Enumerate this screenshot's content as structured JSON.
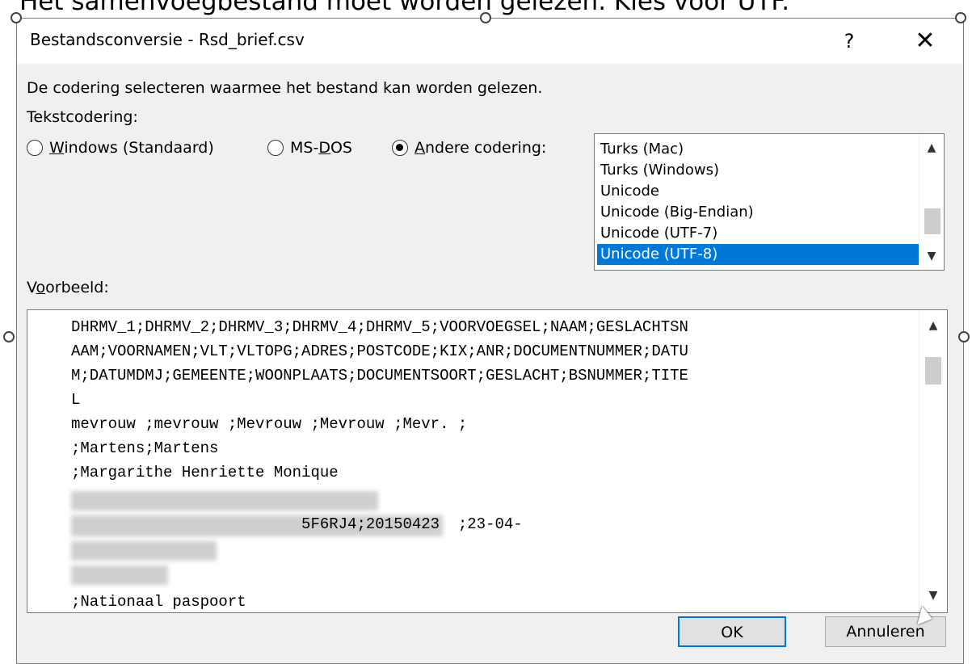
{
  "background": {
    "text": "Het samenvoegbestand moet worden gelezen. Kies voor UTF."
  },
  "dialog": {
    "title": "Bestandsconversie - Rsd_brief.csv",
    "help_label": "?",
    "close_label": "✕",
    "description": "De codering selecteren waarmee het bestand kan worden gelezen.",
    "encoding_label": "Tekstcodering:",
    "radios": [
      {
        "prefix": "",
        "accel": "W",
        "rest": "indows (Standaard)",
        "checked": false
      },
      {
        "prefix": "MS-",
        "accel": "D",
        "rest": "OS",
        "checked": false
      },
      {
        "prefix": "",
        "accel": "A",
        "rest": "ndere codering:",
        "checked": true
      }
    ],
    "encodings": [
      "Turks (Mac)",
      "Turks (Windows)",
      "Unicode",
      "Unicode (Big-Endian)",
      "Unicode (UTF-7)",
      "Unicode (UTF-8)"
    ],
    "selected_encoding": "Unicode (UTF-8)",
    "preview_label": {
      "prefix": "V",
      "accel": "o",
      "rest": "orbeeld:"
    },
    "preview_lines": [
      "DHRMV_1;DHRMV_2;DHRMV_3;DHRMV_4;DHRMV_5;VOORVOEGSEL;NAAM;GESLACHTSN",
      "AAM;VOORNAMEN;VLT;VLTOPG;ADRES;POSTCODE;KIX;ANR;DOCUMENTNUMMER;DATU",
      "M;DATUMDMJ;GEMEENTE;WOONPLAATS;DOCUMENTSOORT;GESLACHT;BSNUMMER;TITE",
      "L",
      "mevrouw ;mevrouw ;Mevrouw ;Mevrouw ;Mevr. ;",
      ";Martens;Martens",
      ";Margarithe Henriette Monique",
      "",
      "                         5F6RJ4;20150423  ;23-04-",
      "",
      "",
      ";Nationaal paspoort"
    ],
    "ok_label": "OK",
    "cancel_label": "Annuleren"
  }
}
